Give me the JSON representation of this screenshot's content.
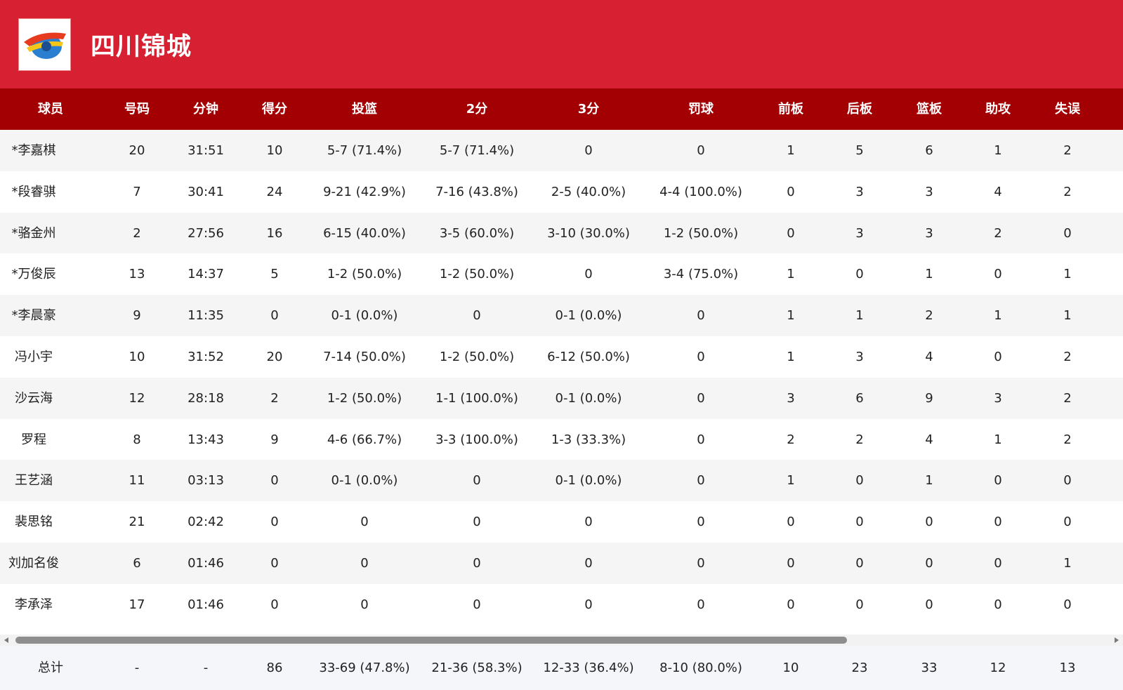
{
  "team": {
    "name": "四川锦城"
  },
  "columns": [
    "球员",
    "号码",
    "分钟",
    "得分",
    "投篮",
    "2分",
    "3分",
    "罚球",
    "前板",
    "后板",
    "篮板",
    "助攻",
    "失误"
  ],
  "rows": [
    [
      "*李嘉棋",
      "20",
      "31:51",
      "10",
      "5-7 (71.4%)",
      "5-7 (71.4%)",
      "0",
      "0",
      "1",
      "5",
      "6",
      "1",
      "2"
    ],
    [
      "*段睿骐",
      "7",
      "30:41",
      "24",
      "9-21 (42.9%)",
      "7-16 (43.8%)",
      "2-5 (40.0%)",
      "4-4 (100.0%)",
      "0",
      "3",
      "3",
      "4",
      "2"
    ],
    [
      "*骆金州",
      "2",
      "27:56",
      "16",
      "6-15 (40.0%)",
      "3-5 (60.0%)",
      "3-10 (30.0%)",
      "1-2 (50.0%)",
      "0",
      "3",
      "3",
      "2",
      "0"
    ],
    [
      "*万俊辰",
      "13",
      "14:37",
      "5",
      "1-2 (50.0%)",
      "1-2 (50.0%)",
      "0",
      "3-4 (75.0%)",
      "1",
      "0",
      "1",
      "0",
      "1"
    ],
    [
      "*李晨豪",
      "9",
      "11:35",
      "0",
      "0-1 (0.0%)",
      "0",
      "0-1 (0.0%)",
      "0",
      "1",
      "1",
      "2",
      "1",
      "1"
    ],
    [
      "冯小宇",
      "10",
      "31:52",
      "20",
      "7-14 (50.0%)",
      "1-2 (50.0%)",
      "6-12 (50.0%)",
      "0",
      "1",
      "3",
      "4",
      "0",
      "2"
    ],
    [
      "沙云海",
      "12",
      "28:18",
      "2",
      "1-2 (50.0%)",
      "1-1 (100.0%)",
      "0-1 (0.0%)",
      "0",
      "3",
      "6",
      "9",
      "3",
      "2"
    ],
    [
      "罗程",
      "8",
      "13:43",
      "9",
      "4-6 (66.7%)",
      "3-3 (100.0%)",
      "1-3 (33.3%)",
      "0",
      "2",
      "2",
      "4",
      "1",
      "2"
    ],
    [
      "王艺涵",
      "11",
      "03:13",
      "0",
      "0-1 (0.0%)",
      "0",
      "0-1 (0.0%)",
      "0",
      "1",
      "0",
      "1",
      "0",
      "0"
    ],
    [
      "裴思铭",
      "21",
      "02:42",
      "0",
      "0",
      "0",
      "0",
      "0",
      "0",
      "0",
      "0",
      "0",
      "0"
    ],
    [
      "刘加名俊",
      "6",
      "01:46",
      "0",
      "0",
      "0",
      "0",
      "0",
      "0",
      "0",
      "0",
      "0",
      "1"
    ],
    [
      "李承泽",
      "17",
      "01:46",
      "0",
      "0",
      "0",
      "0",
      "0",
      "0",
      "0",
      "0",
      "0",
      "0"
    ]
  ],
  "totals": [
    "总计",
    "-",
    "-",
    "86",
    "33-69 (47.8%)",
    "21-36 (58.3%)",
    "12-33 (36.4%)",
    "8-10 (80.0%)",
    "10",
    "23",
    "33",
    "12",
    "13"
  ],
  "colors": {
    "header": "#d72032",
    "table_header": "#a30004"
  },
  "icons": {
    "logo": "team-logo-icon"
  }
}
